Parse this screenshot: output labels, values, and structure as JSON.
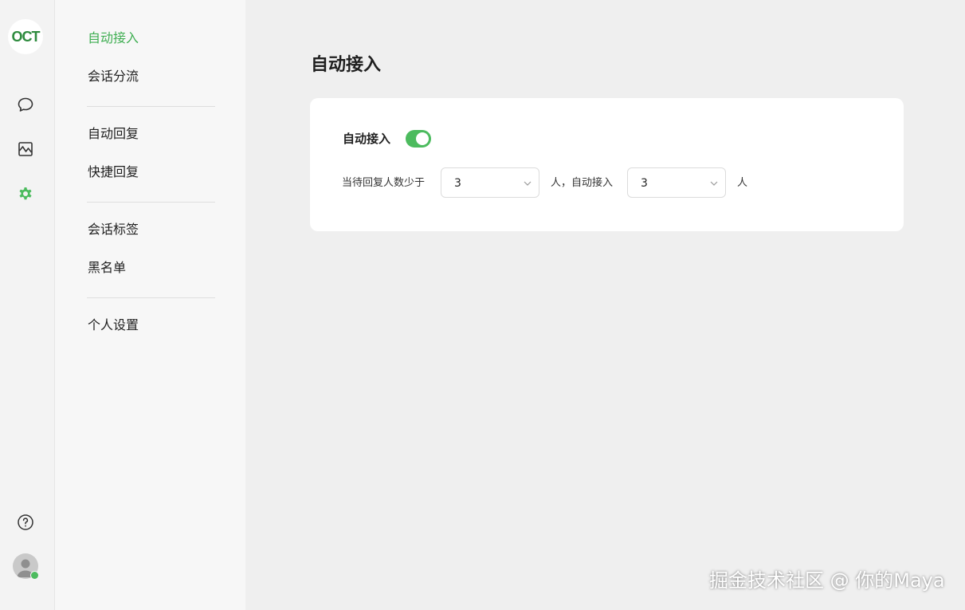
{
  "brand": {
    "logo_text": "OCT"
  },
  "rail": {
    "icons": [
      "chat-bubble-icon",
      "chart-icon",
      "gear-icon",
      "help-icon",
      "avatar"
    ],
    "active": "gear-icon"
  },
  "menu": {
    "items": [
      {
        "label": "自动接入",
        "active": true
      },
      {
        "label": "会话分流"
      },
      {
        "label": "自动回复"
      },
      {
        "label": "快捷回复"
      },
      {
        "label": "会话标签"
      },
      {
        "label": "黑名单"
      },
      {
        "label": "个人设置"
      }
    ]
  },
  "page": {
    "title": "自动接入"
  },
  "card": {
    "switch_label": "自动接入",
    "switch_on": true,
    "rule_prefix": "当待回复人数少于",
    "select_1": {
      "value": "3"
    },
    "rule_middle": "人，自动接入",
    "select_2": {
      "value": "3"
    },
    "rule_suffix": "人"
  },
  "colors": {
    "accent": "#4cbb5e",
    "active_text": "#3fae52",
    "background": "#efefef"
  },
  "watermark": "掘金技术社区 @ 你的Maya"
}
